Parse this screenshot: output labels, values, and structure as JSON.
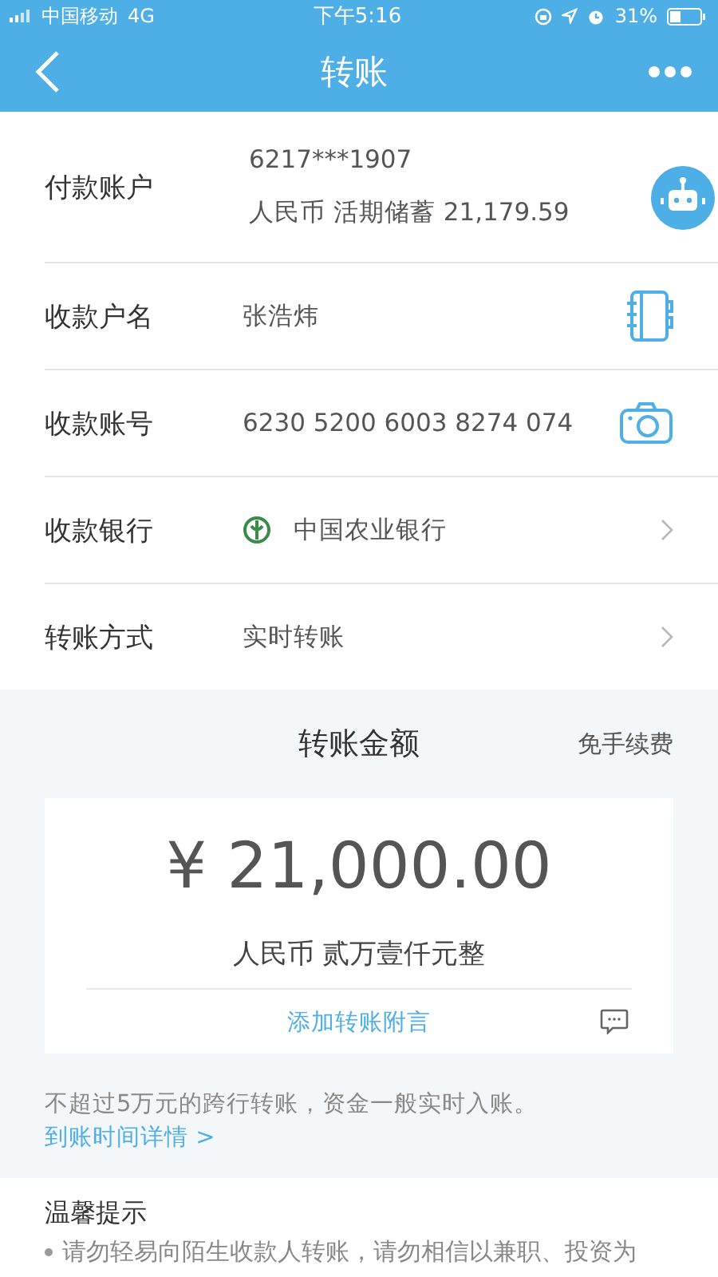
{
  "status_bar": {
    "carrier": "中国移动",
    "network": "4G",
    "time": "下午5:16",
    "battery": "31%"
  },
  "nav": {
    "title": "转账"
  },
  "form": [
    {
      "kind": "account",
      "label": "付款账户",
      "value": "6217***1907",
      "detail": "人民币 活期储蓄 21,179.59"
    },
    {
      "kind": "contacts",
      "label": "收款户名",
      "value": "张浩炜"
    },
    {
      "kind": "camera",
      "label": "收款账号",
      "value": "6230 5200 6003 8274 074"
    },
    {
      "kind": "bank",
      "label": "收款银行",
      "value": "中国农业银行"
    },
    {
      "kind": "select",
      "label": "转账方式",
      "value": "实时转账"
    }
  ],
  "amount": {
    "title": "转账金额",
    "fee_note": "免手续费",
    "value": "¥ 21,000.00",
    "in_words": "人民币 贰万壹仟元整",
    "memo_link": "添加转账附言"
  },
  "note": {
    "text": "不超过5万元的跨行转账，资金一般实时入账。",
    "link": "到账时间详情 >"
  },
  "tips": {
    "title": "温馨提示",
    "items": [
      "请勿轻易向陌生收款人转账，请勿相信以兼职、投资为"
    ]
  }
}
